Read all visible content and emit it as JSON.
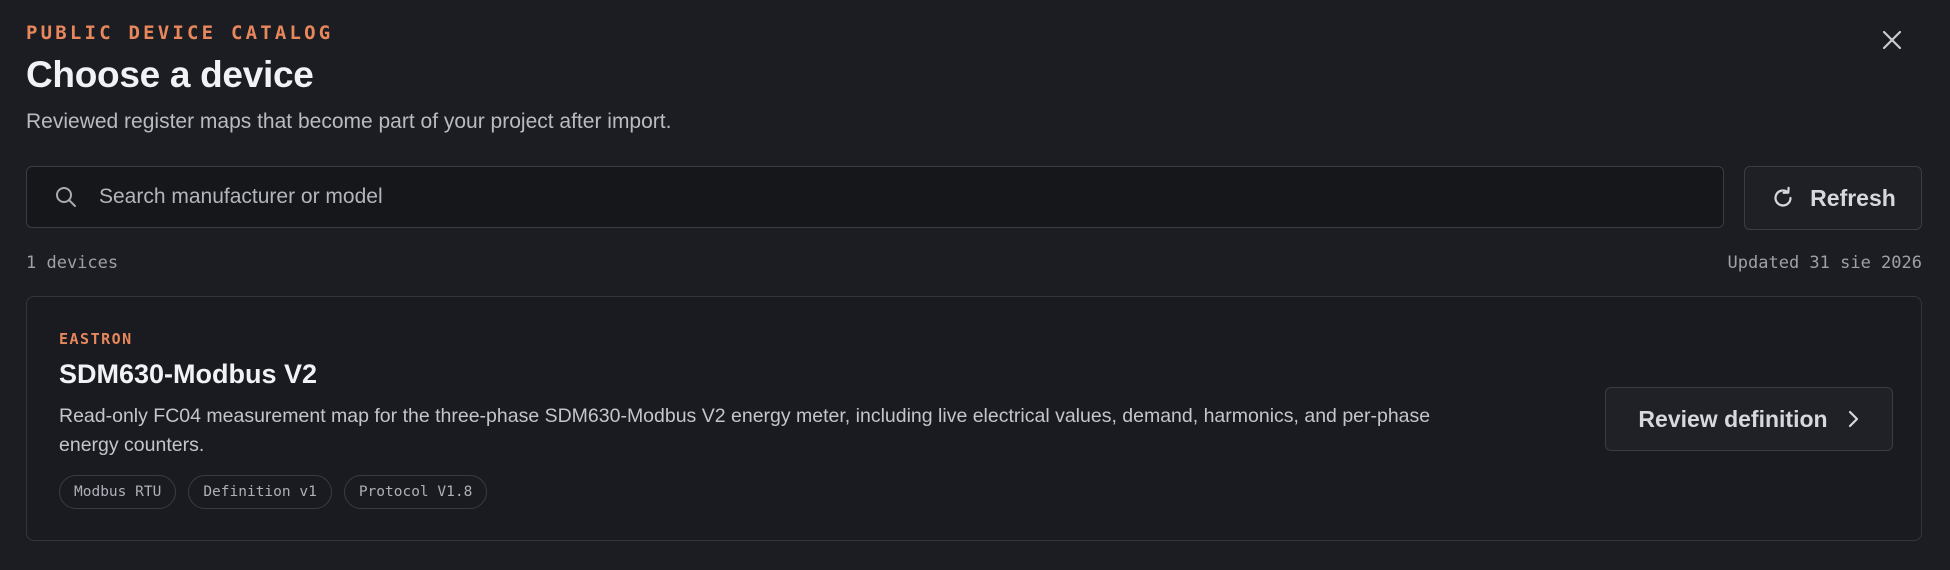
{
  "header": {
    "eyebrow": "PUBLIC DEVICE CATALOG",
    "title": "Choose a device",
    "subtitle": "Reviewed register maps that become part of your project after import.",
    "close_icon": "close-icon"
  },
  "search": {
    "placeholder": "Search manufacturer or model",
    "value": "",
    "icon": "search-icon"
  },
  "refresh": {
    "label": "Refresh",
    "icon": "refresh-icon"
  },
  "meta": {
    "count": "1 devices",
    "updated": "Updated 31 sie 2026"
  },
  "devices": [
    {
      "manufacturer": "EASTRON",
      "model": "SDM630-Modbus V2",
      "description": "Read-only FC04 measurement map for the three-phase SDM630-Modbus V2 energy meter, including live electrical values, demand, harmonics, and per-phase energy counters.",
      "tags": [
        "Modbus RTU",
        "Definition v1",
        "Protocol V1.8"
      ],
      "action_label": "Review definition",
      "action_icon": "chevron-right-icon"
    }
  ],
  "colors": {
    "background": "#1c1d22",
    "accent": "#e8875c",
    "border": "#3a3c44",
    "text": "#e6e7eb"
  }
}
